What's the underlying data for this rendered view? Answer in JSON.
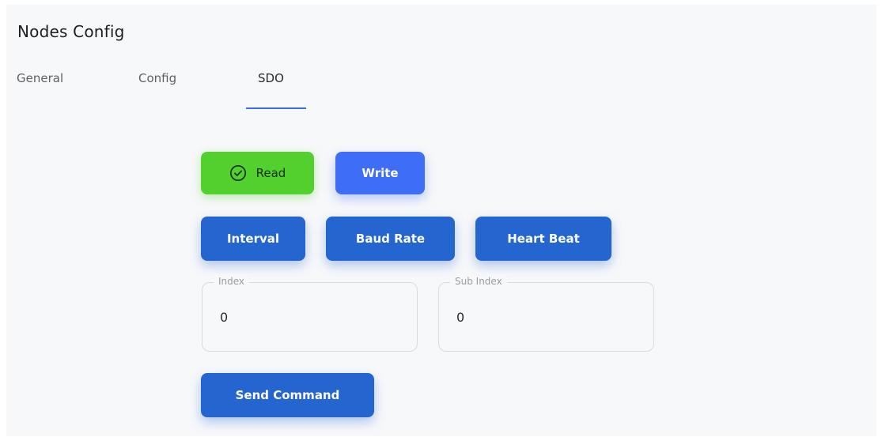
{
  "page": {
    "title": "Nodes Config"
  },
  "tabs": [
    {
      "label": "General"
    },
    {
      "label": "Config"
    },
    {
      "label": "SDO"
    }
  ],
  "mode_buttons": {
    "read_label": "Read",
    "write_label": "Write",
    "read_icon": "check-circle-icon",
    "read_color": "#52d12e",
    "write_color": "#3e6ef5"
  },
  "preset_buttons": [
    {
      "label": "Interval"
    },
    {
      "label": "Baud Rate"
    },
    {
      "label": "Heart Beat"
    }
  ],
  "fields": {
    "index": {
      "label": "Index",
      "value": "0"
    },
    "sub_index": {
      "label": "Sub Index",
      "value": "0"
    }
  },
  "actions": {
    "send_label": "Send Command",
    "color": "#2565d0"
  }
}
